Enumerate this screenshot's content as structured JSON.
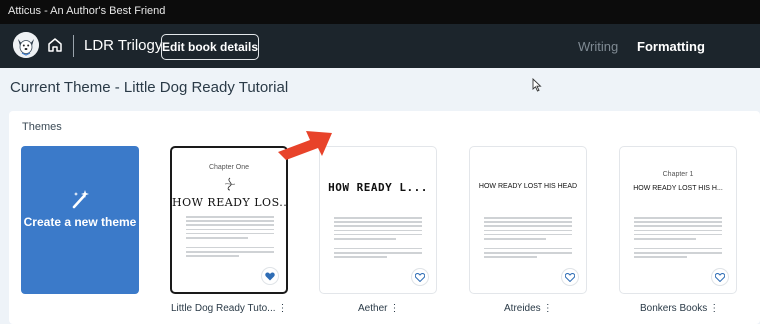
{
  "window": {
    "title": "Atticus - An Author's Best Friend"
  },
  "appbar": {
    "book_title": "LDR Trilogy",
    "edit_button": "Edit book details",
    "nav": {
      "writing": "Writing",
      "formatting": "Formatting"
    }
  },
  "page": {
    "heading": "Current Theme - Little Dog Ready Tutorial",
    "themes_label": "Themes",
    "create_card_label": "Create a new theme"
  },
  "themes": [
    {
      "name": "Little Dog Ready Tuto...",
      "chapter": "Chapter One",
      "title": "HOW READY LOS...",
      "favorited": true,
      "selected": true
    },
    {
      "name": "Aether",
      "chapter": "",
      "title": "HOW READY L...",
      "favorited": false,
      "selected": false
    },
    {
      "name": "Atreides",
      "chapter": "",
      "title": "HOW READY LOST HIS HEAD",
      "favorited": false,
      "selected": false
    },
    {
      "name": "Bonkers Books",
      "chapter": "Chapter 1",
      "title": "HOW READY LOST HIS H...",
      "favorited": false,
      "selected": false
    }
  ],
  "colors": {
    "accent": "#3b7ac9",
    "appbar": "#1c252c",
    "annotation_arrow": "#e8432a",
    "heart": "#2f6db5"
  },
  "icons": {
    "home": "home-icon",
    "wand": "magic-wand-icon",
    "heart": "heart-icon",
    "more": "more-options-icon",
    "logo": "dog-logo-icon"
  }
}
